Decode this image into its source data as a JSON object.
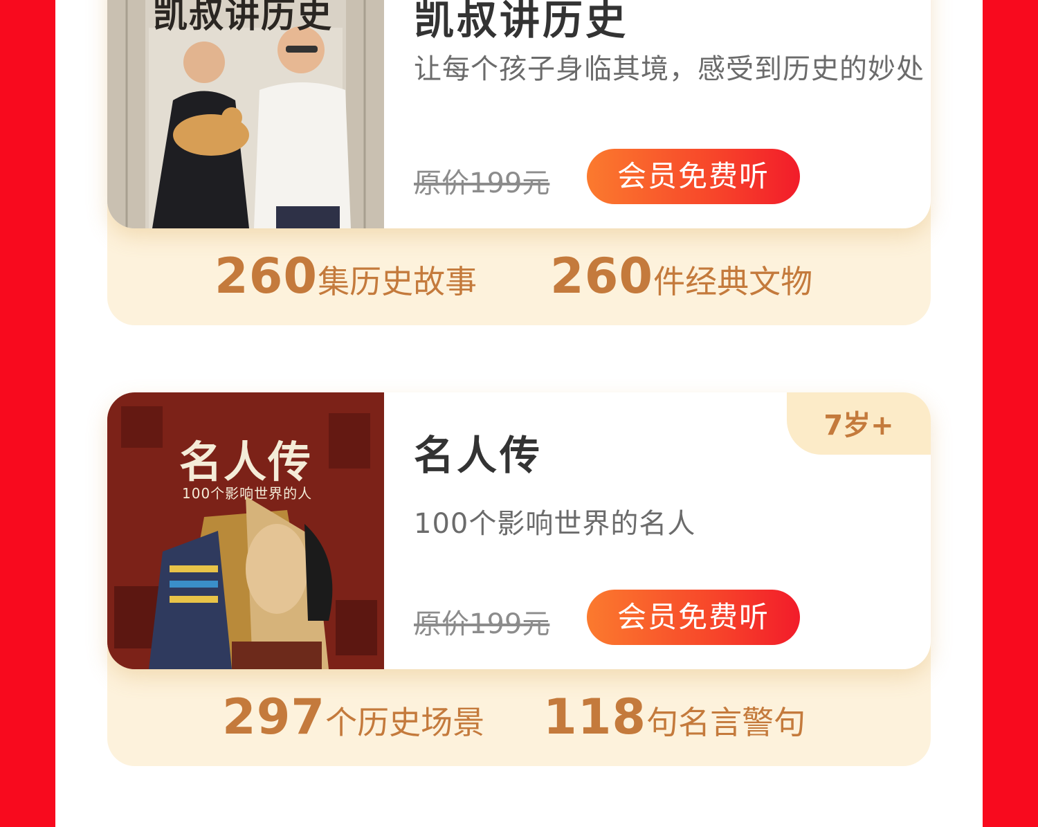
{
  "colors": {
    "background_red": "#f80a1e",
    "accent_orange": "#f7452a",
    "stat_brown": "#c47a3c",
    "stats_band": "#fdf2dc",
    "age_tag": "#fcebc8"
  },
  "courses": [
    {
      "title": "凯叔讲历史",
      "cover_title": "凯叔讲历史",
      "description": "让每个孩子身临其境，感受到历史的妙处",
      "original_price": "原价199元",
      "button_label": "会员免费听",
      "stats": [
        {
          "number": "260",
          "label": "集历史故事"
        },
        {
          "number": "260",
          "label": "件经典文物"
        }
      ]
    },
    {
      "title": "名人传",
      "cover_title": "名人传",
      "cover_subtitle": "100个影响世界的人",
      "description": "100个影响世界的名人",
      "original_price": "原价199元",
      "button_label": "会员免费听",
      "age_tag": "7岁+",
      "stats": [
        {
          "number": "297",
          "label": "个历史场景"
        },
        {
          "number": "118",
          "label": "句名言警句"
        }
      ]
    }
  ]
}
